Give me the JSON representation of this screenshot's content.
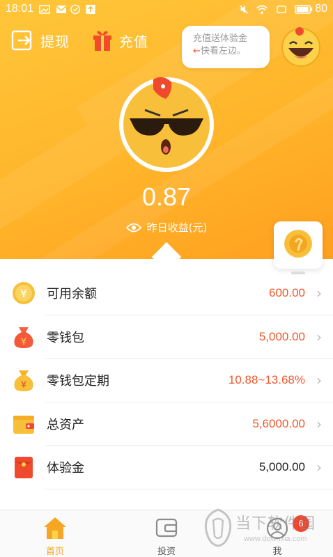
{
  "status_bar": {
    "time": "18:01",
    "battery": "80"
  },
  "header": {
    "withdraw_label": "提现",
    "recharge_label": "充值",
    "tooltip_line1": "充值送体验金",
    "tooltip_arrow": "←",
    "tooltip_line2": "快看左边。"
  },
  "earnings": {
    "value": "0.87",
    "label": "昨日收益(元)"
  },
  "list": [
    {
      "icon": "yuan-coin-icon",
      "name": "可用余额",
      "value": "600.00",
      "value_color": "#f2582c"
    },
    {
      "icon": "money-bag-red-icon",
      "name": "零钱包",
      "value": "5,000.00",
      "value_color": "#f2582c"
    },
    {
      "icon": "money-bag-gold-icon",
      "name": "零钱包定期",
      "value": "10.88~13.68%",
      "value_color": "#f2582c"
    },
    {
      "icon": "wallet-icon",
      "name": "总资产",
      "value": "5,6000.00",
      "value_color": "#f2582c"
    },
    {
      "icon": "red-envelope-icon",
      "name": "体验金",
      "value": "5,000.00",
      "value_color": "#222222"
    }
  ],
  "bottom_nav": {
    "home": "首页",
    "invest": "投资",
    "me": "我",
    "me_badge": "6"
  },
  "watermark": {
    "line1": "当下软件园",
    "line2": "www.downxia.com"
  },
  "colors": {
    "brand_orange": "#ffb52a",
    "accent_red": "#f2582c",
    "active_tab": "#f5a623"
  }
}
